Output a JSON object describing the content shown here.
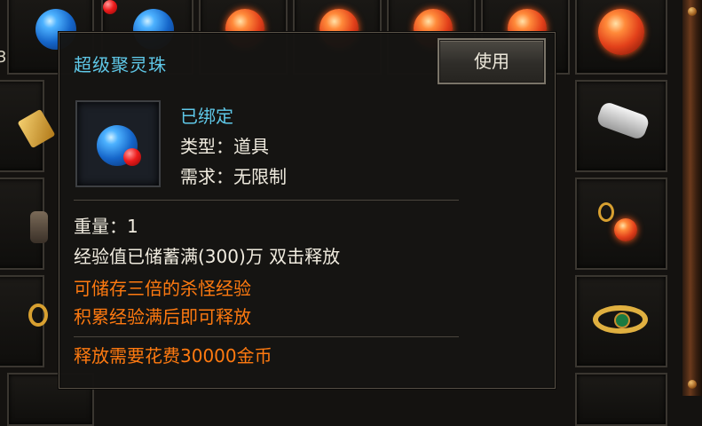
{
  "edge_digit": "3",
  "tooltip": {
    "title": "超级聚灵珠",
    "use_button": "使用",
    "bound": "已绑定",
    "type_label": "类型：",
    "type_value": "道具",
    "req_label": "需求：",
    "req_value": "无限制",
    "weight_label": "重量：",
    "weight_value": "1",
    "exp_line": "经验值已储蓄满(300)万 双击释放",
    "note1": "可储存三倍的杀怪经验",
    "note2": "积累经验满后即可释放",
    "cost_line": "释放需要花费30000金币"
  },
  "icons": {
    "item_icon": "blue-orb-with-red-dot-icon",
    "grid_items": [
      "blue-orb-icon",
      "blue-orb-icon",
      "red-orb-icon",
      "red-orb-icon",
      "red-orb-icon",
      "red-orb-icon",
      "red-orb-icon",
      "gold-scroll-icon",
      "silver-bracelet-icon",
      "dark-pot-icon",
      "gold-amulet-icon",
      "gold-ring-icon",
      "gold-ring-icon"
    ]
  },
  "colors": {
    "title_blue": "#5fc8e8",
    "bound_blue": "#5fc8e8",
    "text_white": "#f0ebdf",
    "orange": "#ff7a10"
  }
}
